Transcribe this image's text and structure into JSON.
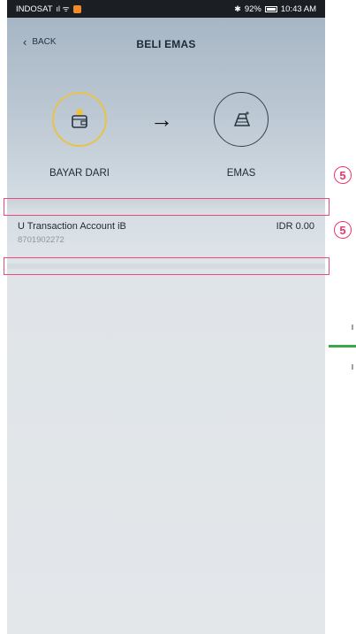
{
  "status_bar": {
    "carrier": "INDOSAT",
    "signal_icons": "ıl ᯤ",
    "battery_text": "92%",
    "time": "10:43 AM"
  },
  "header": {
    "back_label": "BACK",
    "title": "BELI EMAS"
  },
  "flow": {
    "source_label": "BAYAR DARI",
    "target_label": "EMAS",
    "arrow": "→"
  },
  "account": {
    "name": "U Transaction Account iB",
    "balance": "IDR 0.00",
    "number": "8701902272"
  },
  "annotations": {
    "badge_1": "5",
    "badge_2": "5"
  },
  "colors": {
    "highlight": "#e94c7a",
    "source_ring": "#e8c24a",
    "connector": "#3aa84a"
  }
}
